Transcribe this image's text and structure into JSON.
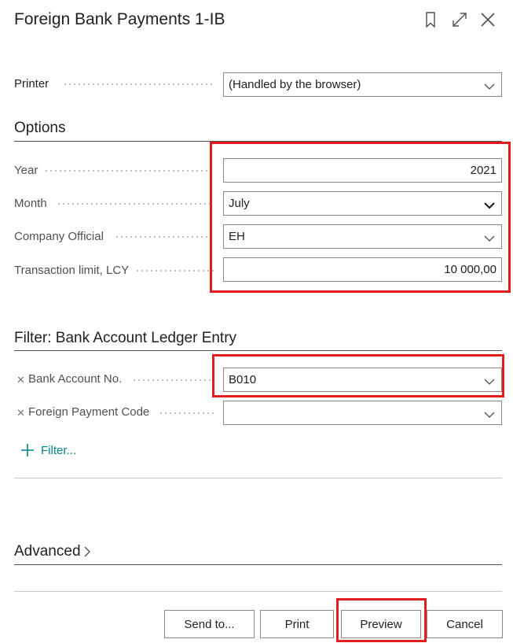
{
  "window": {
    "title": "Foreign Bank Payments 1-IB"
  },
  "printer": {
    "label": "Printer",
    "value": "(Handled by the browser)"
  },
  "options": {
    "title": "Options",
    "year": {
      "label": "Year",
      "value": "2021"
    },
    "month": {
      "label": "Month",
      "value": "July"
    },
    "company_official": {
      "label": "Company Official",
      "value": "EH"
    },
    "transaction_limit": {
      "label": "Transaction limit, LCY",
      "value": "10 000,00"
    }
  },
  "filter": {
    "title": "Filter: Bank Account Ledger Entry",
    "bank_account_no": {
      "label": "Bank Account No.",
      "value": "B010"
    },
    "foreign_payment_code": {
      "label": "Foreign Payment Code",
      "value": ""
    },
    "add_filter_label": "Filter..."
  },
  "advanced": {
    "title": "Advanced"
  },
  "buttons": {
    "send_to": "Send to...",
    "print": "Print",
    "preview": "Preview",
    "cancel": "Cancel"
  },
  "colors": {
    "highlight": "#e11d1d",
    "accent": "#008489"
  }
}
